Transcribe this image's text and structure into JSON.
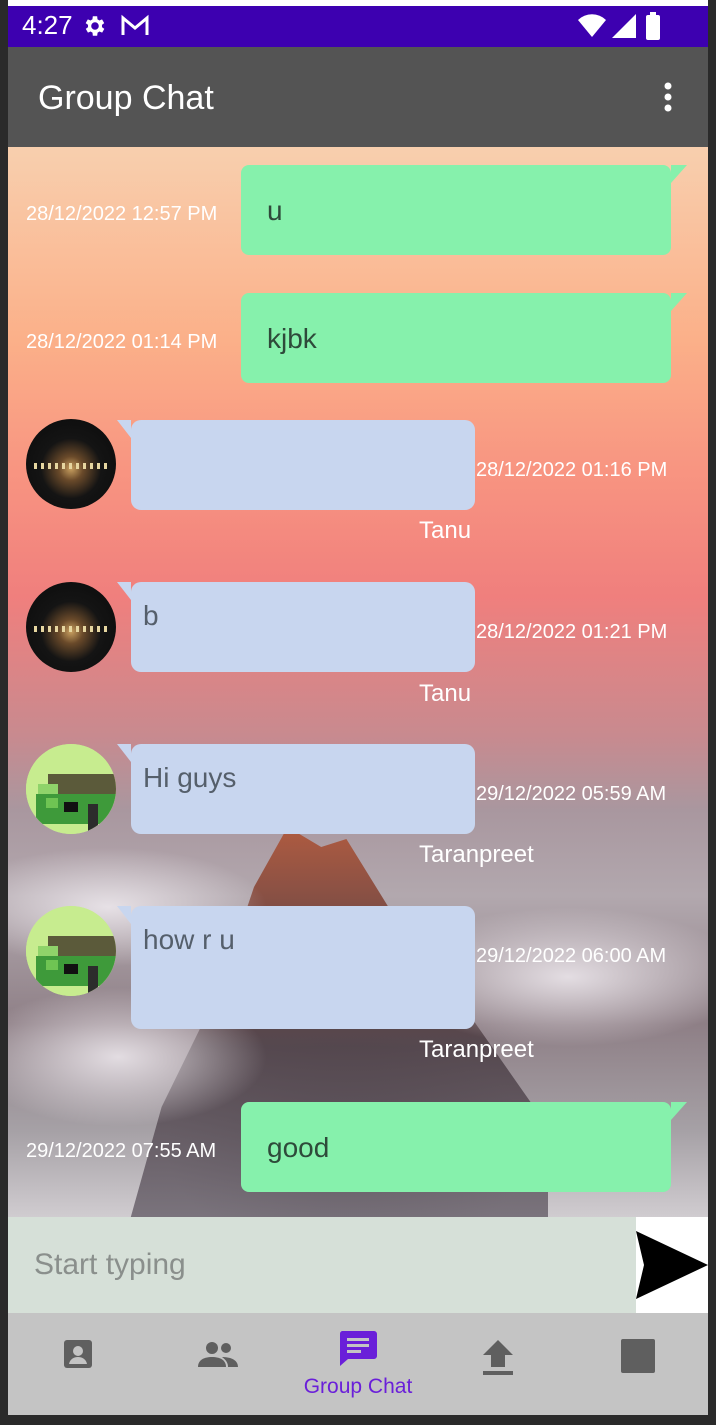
{
  "status_bar": {
    "time": "4:27",
    "icons": [
      "gear-icon",
      "gmail-icon",
      "wifi-icon",
      "signal-icon",
      "battery-icon"
    ],
    "background": "#3d00b0"
  },
  "app_bar": {
    "title": "Group Chat",
    "menu_icon": "more-vert-icon",
    "background": "#545454"
  },
  "messages": [
    {
      "direction": "outgoing",
      "text": "u",
      "timestamp": "28/12/2022 12:57 PM"
    },
    {
      "direction": "outgoing",
      "text": "kjbk",
      "timestamp": "28/12/2022 01:14 PM"
    },
    {
      "direction": "incoming",
      "text": "",
      "timestamp": "28/12/2022 01:16 PM",
      "sender": "Tanu",
      "avatar": "night-temple-avatar"
    },
    {
      "direction": "incoming",
      "text": "b",
      "timestamp": "28/12/2022 01:21 PM",
      "sender": "Tanu",
      "avatar": "night-temple-avatar"
    },
    {
      "direction": "incoming",
      "text": "Hi guys",
      "timestamp": "29/12/2022 05:59 AM",
      "sender": "Taranpreet",
      "avatar": "pixel-art-avatar"
    },
    {
      "direction": "incoming",
      "text": "how r u",
      "timestamp": "29/12/2022 06:00 AM",
      "sender": "Taranpreet",
      "avatar": "pixel-art-avatar"
    },
    {
      "direction": "outgoing",
      "text": "good",
      "timestamp": "29/12/2022 07:55 AM"
    }
  ],
  "colors": {
    "outgoing_bubble": "#86f1ac",
    "incoming_bubble": "#c8d6ef",
    "nav_active": "#6a1fd9"
  },
  "composer": {
    "placeholder": "Start typing",
    "value": "",
    "send_icon": "send-arrow-icon"
  },
  "bottom_nav": {
    "items": [
      {
        "icon": "profile-card-icon",
        "label": "",
        "active": false
      },
      {
        "icon": "people-icon",
        "label": "",
        "active": false
      },
      {
        "icon": "chat-icon",
        "label": "Group Chat",
        "active": true
      },
      {
        "icon": "upload-icon",
        "label": "",
        "active": false
      },
      {
        "icon": "stop-square-icon",
        "label": "",
        "active": false
      }
    ]
  }
}
